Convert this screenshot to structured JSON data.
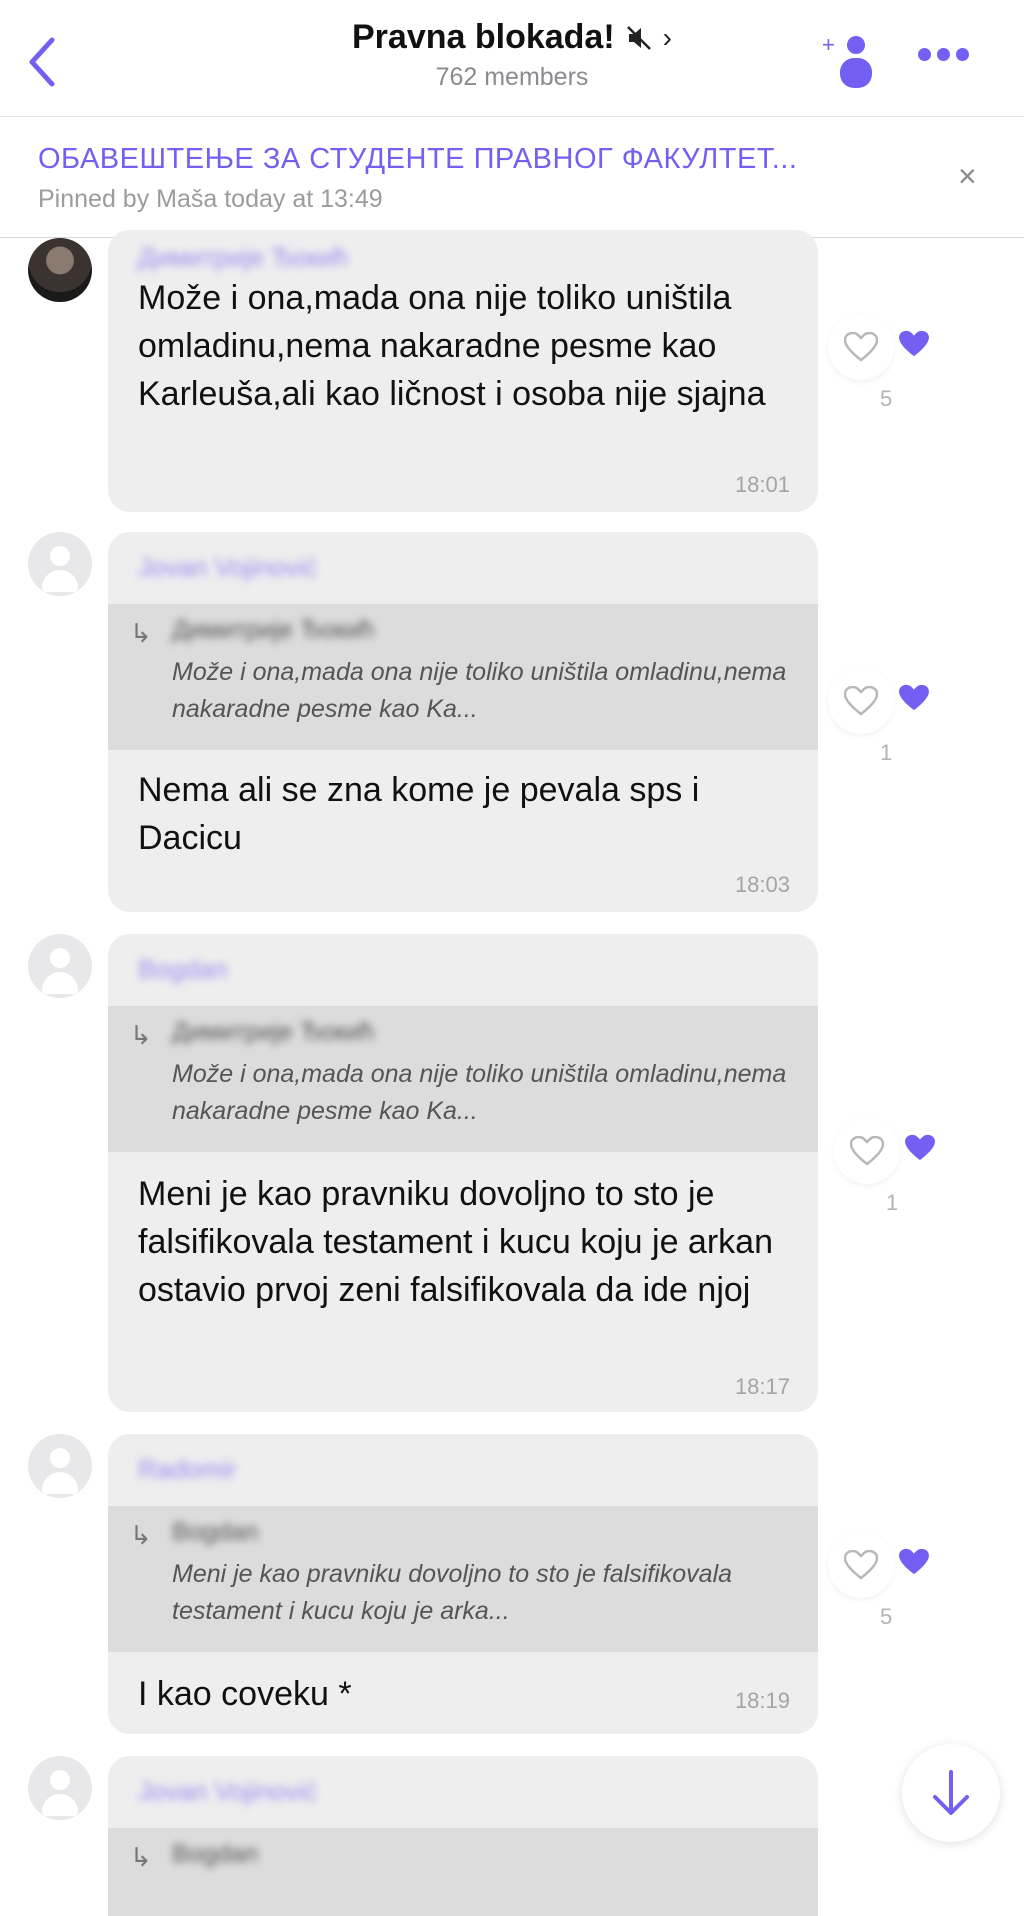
{
  "header": {
    "title": "Pravna blokada!",
    "chevron": "›",
    "members": "762 members",
    "accent": "#7360f2"
  },
  "pinned": {
    "title": "ОБАВЕШТЕЊЕ ЗА СТУДЕНТЕ ПРАВНОГ ФАКУЛТЕТ...",
    "meta": "Pinned by Maša today at 13:49",
    "close": "×"
  },
  "messages": [
    {
      "sender": "Димитрије Ђокић",
      "text": "Može i ona,mada ona nije toliko uništila omladinu,nema nakaradne pesme kao Karleuša,ali kao ličnost i osoba nije sjajna",
      "time": "18:01",
      "likes": "5"
    },
    {
      "sender": "Jovan Vojinović",
      "quote_arrow": "↳",
      "quote_author": "Димитрије Ђокић",
      "quote_text": "Može i ona,mada ona nije toliko uništila omladinu,nema nakaradne pesme kao Ka...",
      "text": "Nema ali se zna kome je pevala sps i Dacicu",
      "time": "18:03",
      "likes": "1"
    },
    {
      "sender": "Bogdan",
      "quote_arrow": "↳",
      "quote_author": "Димитрије Ђокић",
      "quote_text": "Može i ona,mada ona nije toliko uništila omladinu,nema nakaradne pesme kao Ka...",
      "text": "Meni je kao pravniku dovoljno to sto je falsifikovala testament i kucu koju je arkan ostavio prvoj zeni falsifikovala da ide njoj",
      "time": "18:17",
      "likes": "1"
    },
    {
      "sender": "Radomir",
      "quote_arrow": "↳",
      "quote_author": "Bogdan",
      "quote_text": "Meni je kao pravniku dovoljno to sto je falsifikovala testament i kucu koju je arka...",
      "text": "I kao coveku *",
      "time": "18:19",
      "likes": "5"
    },
    {
      "sender": "Jovan Vojinović",
      "quote_arrow": "↳",
      "quote_author": "Bogdan"
    }
  ]
}
